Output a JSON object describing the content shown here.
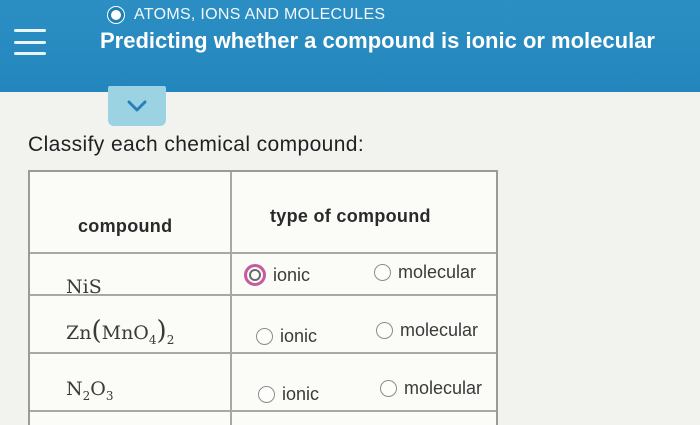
{
  "header": {
    "topic": "ATOMS, IONS AND MOLECULES",
    "title": "Predicting whether a compound is ionic or molecular"
  },
  "prompt": "Classify each chemical compound:",
  "table": {
    "headers": [
      "compound",
      "type of compound"
    ],
    "options": [
      "ionic",
      "molecular"
    ],
    "rows": [
      {
        "compound": "NiS"
      },
      {
        "compound": "Zn(MnO4)2"
      },
      {
        "compound": "N2O3"
      }
    ]
  },
  "colors": {
    "header_bg": "#2386bc",
    "expand_tab": "#9bd3e3",
    "focus_ring": "#c85aa0"
  }
}
